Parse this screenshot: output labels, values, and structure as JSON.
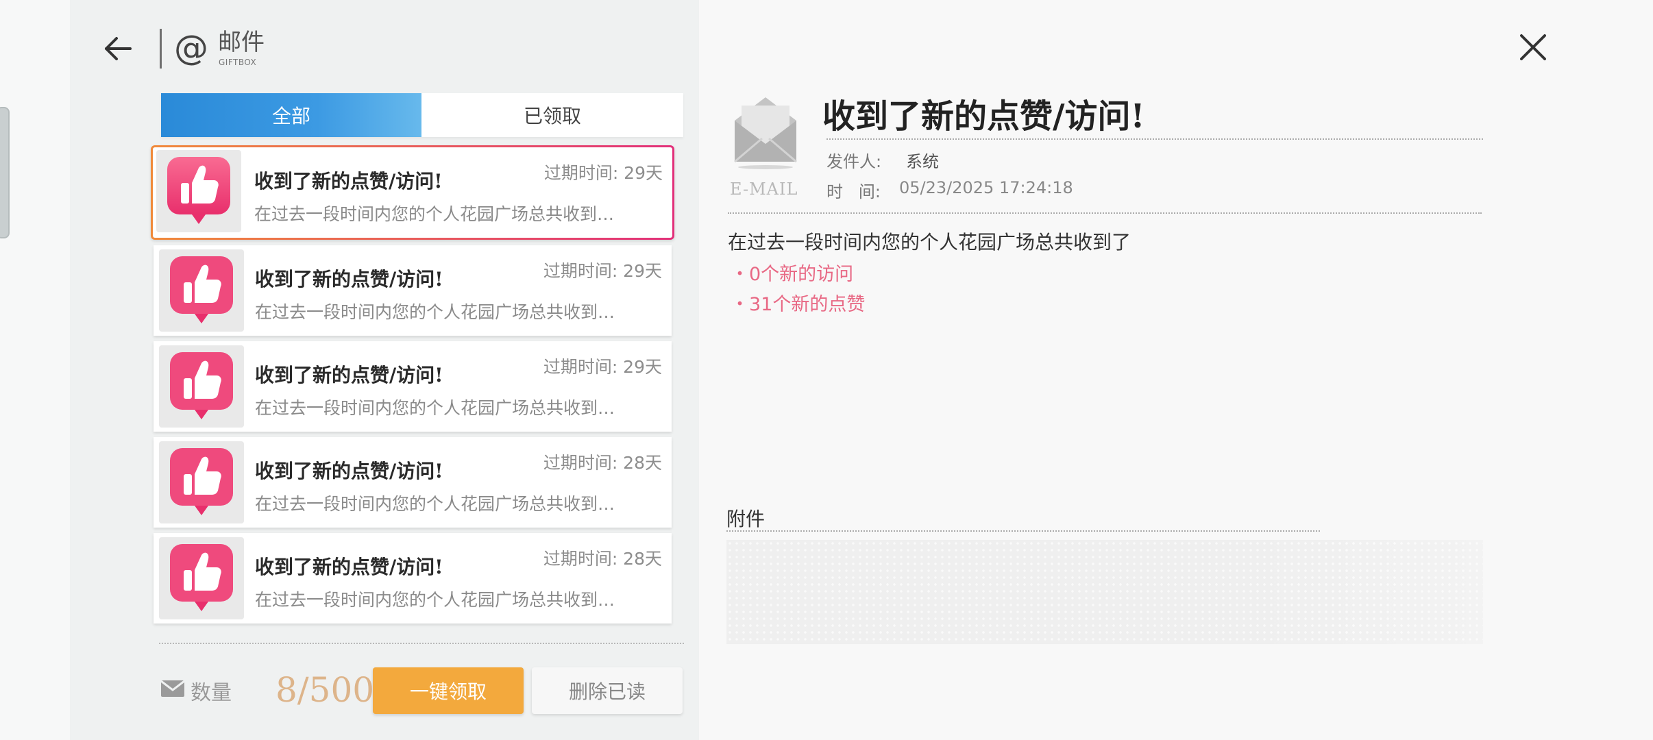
{
  "header": {
    "title": "邮件",
    "subtitle": "GIFTBOX"
  },
  "tabs": [
    {
      "label": "全部",
      "active": true
    },
    {
      "label": "已领取",
      "active": false
    }
  ],
  "mail_list": [
    {
      "title": "收到了新的点赞/访问!",
      "preview": "在过去一段时间内您的个人花园广场总共收到…",
      "expiry": "过期时间: 29天",
      "selected": true
    },
    {
      "title": "收到了新的点赞/访问!",
      "preview": "在过去一段时间内您的个人花园广场总共收到…",
      "expiry": "过期时间: 29天",
      "selected": false
    },
    {
      "title": "收到了新的点赞/访问!",
      "preview": "在过去一段时间内您的个人花园广场总共收到…",
      "expiry": "过期时间: 29天",
      "selected": false
    },
    {
      "title": "收到了新的点赞/访问!",
      "preview": "在过去一段时间内您的个人花园广场总共收到…",
      "expiry": "过期时间: 28天",
      "selected": false
    },
    {
      "title": "收到了新的点赞/访问!",
      "preview": "在过去一段时间内您的个人花园广场总共收到…",
      "expiry": "过期时间: 28天",
      "selected": false
    }
  ],
  "footer": {
    "count_label": "数量",
    "count_value": "8/500",
    "claim_all_label": "一键领取",
    "delete_read_label": "删除已读"
  },
  "detail": {
    "icon_caption": "E-MAIL",
    "title": "收到了新的点赞/访问!",
    "sender_label": "发件人:",
    "sender_value": "系统",
    "time_label": "时   间:",
    "time_value": "05/23/2025 17:24:18",
    "body_intro": "在过去一段时间内您的个人花园广场总共收到了",
    "body_lines": [
      "・0个新的访问",
      "・31个新的点赞"
    ],
    "attachment_label": "附件"
  },
  "colors": {
    "tab_active": "#2a8ad8",
    "highlight_pink": "#e86884",
    "claim_button": "#f3a93d",
    "count_value": "#ddb48a",
    "like_icon": "#f0457a"
  },
  "icons": {
    "back": "back-arrow-icon",
    "close": "close-icon",
    "header": "at-sign-icon",
    "mail_item": "thumbs-up-icon",
    "detail": "envelope-icon",
    "count": "mail-icon"
  }
}
